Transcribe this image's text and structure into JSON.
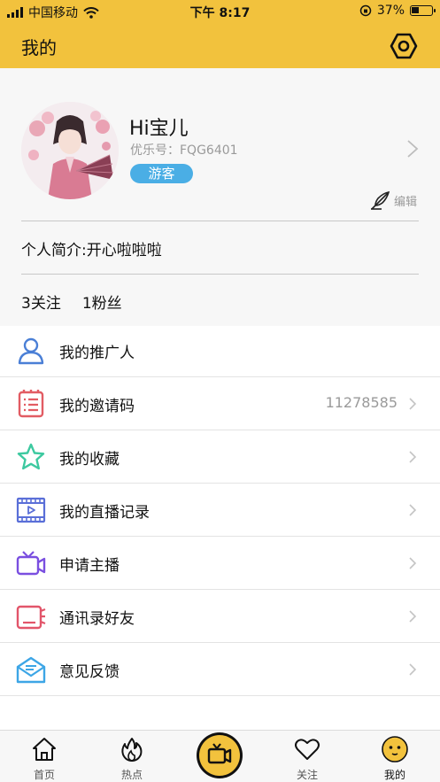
{
  "status_bar": {
    "carrier": "中国移动",
    "time": "下午 8:17",
    "battery_percent": "37%",
    "battery_level": 0.37
  },
  "nav": {
    "title": "我的",
    "settings_icon": "settings-hexagon-icon"
  },
  "profile": {
    "name": "Hi宝儿",
    "id_label": "优乐号：FQG6401",
    "role_badge": "游客",
    "edit_label": "编辑",
    "bio": "个人简介:开心啦啦啦",
    "following": "3关注",
    "followers": "1粉丝"
  },
  "menu": [
    {
      "label": "我的推广人",
      "value": "",
      "icon": "user-icon",
      "color": "#4a7fd6",
      "chevron": false
    },
    {
      "label": "我的邀请码",
      "value": "11278585",
      "icon": "invite-code-icon",
      "color": "#e25c63",
      "chevron": true
    },
    {
      "label": "我的收藏",
      "value": "",
      "icon": "star-icon",
      "color": "#3dc9a0",
      "chevron": true
    },
    {
      "label": "我的直播记录",
      "value": "",
      "icon": "video-record-icon",
      "color": "#5a6fd8",
      "chevron": true
    },
    {
      "label": "申请主播",
      "value": "",
      "icon": "camera-icon",
      "color": "#7a4fe0",
      "chevron": true
    },
    {
      "label": "通讯录好友",
      "value": "",
      "icon": "contacts-icon",
      "color": "#e2556a",
      "chevron": true
    },
    {
      "label": "意见反馈",
      "value": "",
      "icon": "feedback-mail-icon",
      "color": "#3da6e6",
      "chevron": true
    }
  ],
  "tabs": [
    {
      "label": "首页",
      "icon": "home-icon"
    },
    {
      "label": "热点",
      "icon": "flame-icon"
    },
    {
      "label": "",
      "icon": "live-camera-icon"
    },
    {
      "label": "关注",
      "icon": "heart-icon"
    },
    {
      "label": "我的",
      "icon": "smiley-icon"
    }
  ],
  "colors": {
    "accent": "#f2c23d",
    "badge": "#4aaee5"
  }
}
